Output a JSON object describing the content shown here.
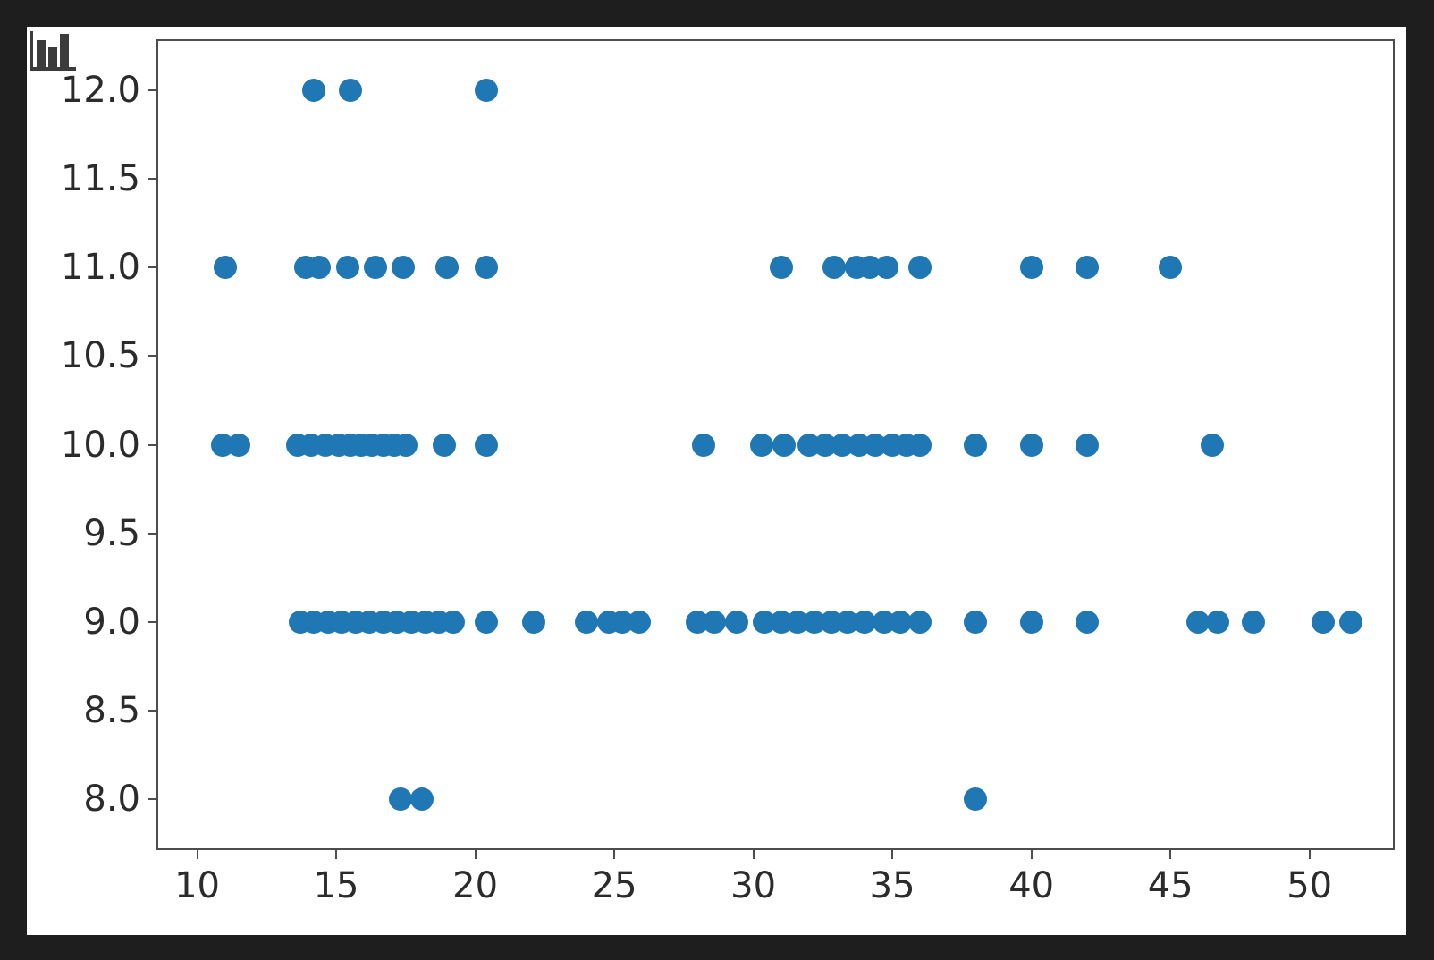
{
  "window": {
    "background_color": "#1e1e1e",
    "figure_background": "#ffffff"
  },
  "app_icon": {
    "name": "bar-chart-icon",
    "color": "#3c3c3c"
  },
  "chart_data": {
    "type": "scatter",
    "title": "",
    "xlabel": "",
    "ylabel": "",
    "marker_color": "#1f77b4",
    "marker_size": 26,
    "grid": false,
    "legend": null,
    "xlim": [
      8.6,
      53.0
    ],
    "ylim": [
      7.72,
      12.28
    ],
    "xticks": [
      10,
      15,
      20,
      25,
      30,
      35,
      40,
      45,
      50
    ],
    "xticklabels": [
      "10",
      "15",
      "20",
      "25",
      "30",
      "35",
      "40",
      "45",
      "50"
    ],
    "yticks": [
      8.0,
      8.5,
      9.0,
      9.5,
      10.0,
      10.5,
      11.0,
      11.5,
      12.0
    ],
    "yticklabels": [
      "8.0",
      "8.5",
      "9.0",
      "9.5",
      "10.0",
      "10.5",
      "11.0",
      "11.5",
      "12.0"
    ],
    "points": [
      {
        "x": 14.2,
        "y": 12.0
      },
      {
        "x": 15.5,
        "y": 12.0
      },
      {
        "x": 20.4,
        "y": 12.0
      },
      {
        "x": 11.0,
        "y": 11.0
      },
      {
        "x": 13.9,
        "y": 11.0
      },
      {
        "x": 14.4,
        "y": 11.0
      },
      {
        "x": 15.4,
        "y": 11.0
      },
      {
        "x": 16.4,
        "y": 11.0
      },
      {
        "x": 17.4,
        "y": 11.0
      },
      {
        "x": 19.0,
        "y": 11.0
      },
      {
        "x": 20.4,
        "y": 11.0
      },
      {
        "x": 31.0,
        "y": 11.0
      },
      {
        "x": 32.9,
        "y": 11.0
      },
      {
        "x": 33.7,
        "y": 11.0
      },
      {
        "x": 34.2,
        "y": 11.0
      },
      {
        "x": 34.8,
        "y": 11.0
      },
      {
        "x": 36.0,
        "y": 11.0
      },
      {
        "x": 40.0,
        "y": 11.0
      },
      {
        "x": 42.0,
        "y": 11.0
      },
      {
        "x": 45.0,
        "y": 11.0
      },
      {
        "x": 10.9,
        "y": 10.0
      },
      {
        "x": 11.5,
        "y": 10.0
      },
      {
        "x": 13.6,
        "y": 10.0
      },
      {
        "x": 14.1,
        "y": 10.0
      },
      {
        "x": 14.6,
        "y": 10.0
      },
      {
        "x": 15.1,
        "y": 10.0
      },
      {
        "x": 15.5,
        "y": 10.0
      },
      {
        "x": 15.9,
        "y": 10.0
      },
      {
        "x": 16.3,
        "y": 10.0
      },
      {
        "x": 16.7,
        "y": 10.0
      },
      {
        "x": 17.1,
        "y": 10.0
      },
      {
        "x": 17.5,
        "y": 10.0
      },
      {
        "x": 18.9,
        "y": 10.0
      },
      {
        "x": 20.4,
        "y": 10.0
      },
      {
        "x": 28.2,
        "y": 10.0
      },
      {
        "x": 30.3,
        "y": 10.0
      },
      {
        "x": 31.1,
        "y": 10.0
      },
      {
        "x": 32.0,
        "y": 10.0
      },
      {
        "x": 32.6,
        "y": 10.0
      },
      {
        "x": 33.2,
        "y": 10.0
      },
      {
        "x": 33.8,
        "y": 10.0
      },
      {
        "x": 34.4,
        "y": 10.0
      },
      {
        "x": 35.0,
        "y": 10.0
      },
      {
        "x": 35.5,
        "y": 10.0
      },
      {
        "x": 36.0,
        "y": 10.0
      },
      {
        "x": 38.0,
        "y": 10.0
      },
      {
        "x": 40.0,
        "y": 10.0
      },
      {
        "x": 42.0,
        "y": 10.0
      },
      {
        "x": 46.5,
        "y": 10.0
      },
      {
        "x": 13.7,
        "y": 9.0
      },
      {
        "x": 14.2,
        "y": 9.0
      },
      {
        "x": 14.7,
        "y": 9.0
      },
      {
        "x": 15.2,
        "y": 9.0
      },
      {
        "x": 15.7,
        "y": 9.0
      },
      {
        "x": 16.2,
        "y": 9.0
      },
      {
        "x": 16.7,
        "y": 9.0
      },
      {
        "x": 17.2,
        "y": 9.0
      },
      {
        "x": 17.7,
        "y": 9.0
      },
      {
        "x": 18.2,
        "y": 9.0
      },
      {
        "x": 18.7,
        "y": 9.0
      },
      {
        "x": 19.2,
        "y": 9.0
      },
      {
        "x": 20.4,
        "y": 9.0
      },
      {
        "x": 22.1,
        "y": 9.0
      },
      {
        "x": 24.0,
        "y": 9.0
      },
      {
        "x": 24.8,
        "y": 9.0
      },
      {
        "x": 25.3,
        "y": 9.0
      },
      {
        "x": 25.9,
        "y": 9.0
      },
      {
        "x": 28.0,
        "y": 9.0
      },
      {
        "x": 28.6,
        "y": 9.0
      },
      {
        "x": 29.4,
        "y": 9.0
      },
      {
        "x": 30.4,
        "y": 9.0
      },
      {
        "x": 31.0,
        "y": 9.0
      },
      {
        "x": 31.6,
        "y": 9.0
      },
      {
        "x": 32.2,
        "y": 9.0
      },
      {
        "x": 32.8,
        "y": 9.0
      },
      {
        "x": 33.4,
        "y": 9.0
      },
      {
        "x": 34.0,
        "y": 9.0
      },
      {
        "x": 34.7,
        "y": 9.0
      },
      {
        "x": 35.3,
        "y": 9.0
      },
      {
        "x": 36.0,
        "y": 9.0
      },
      {
        "x": 38.0,
        "y": 9.0
      },
      {
        "x": 40.0,
        "y": 9.0
      },
      {
        "x": 42.0,
        "y": 9.0
      },
      {
        "x": 46.0,
        "y": 9.0
      },
      {
        "x": 46.7,
        "y": 9.0
      },
      {
        "x": 48.0,
        "y": 9.0
      },
      {
        "x": 50.5,
        "y": 9.0
      },
      {
        "x": 51.5,
        "y": 9.0
      },
      {
        "x": 17.3,
        "y": 8.0
      },
      {
        "x": 18.1,
        "y": 8.0
      },
      {
        "x": 38.0,
        "y": 8.0
      }
    ]
  }
}
